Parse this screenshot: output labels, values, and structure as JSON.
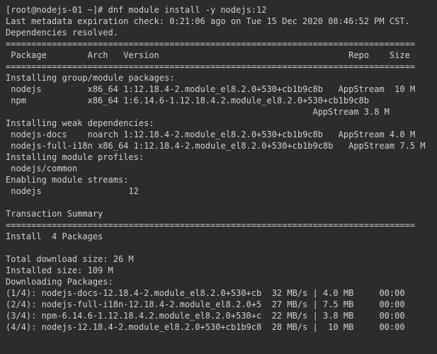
{
  "prompt": "[root@nodejs-01 ~]# ",
  "command": "dnf module install -y nodejs:12",
  "meta_line": "Last metadata expiration check: 0:21:06 ago on Tue 15 Dec 2020 08:46:52 PM CST.",
  "deps_resolved": "Dependencies resolved.",
  "hr": "================================================================================",
  "header": {
    "package": "Package",
    "arch": "Arch",
    "version": "Version",
    "repo": "Repo",
    "size": "Size"
  },
  "sections": {
    "group_packages": "Installing group/module packages:",
    "weak_deps": "Installing weak dependencies:",
    "module_profiles": "Installing module profiles:",
    "module_streams": "Enabling module streams:",
    "transaction_summary": "Transaction Summary",
    "install_n": "Install  4 Packages",
    "total_dl": "Total download size: 26 M",
    "installed_size": "Installed size: 109 M",
    "downloading": "Downloading Packages:"
  },
  "pkg": {
    "nodejs": {
      "name": " nodejs",
      "arch": "x86_64",
      "version": "1:12.18.4-2.module_el8.2.0+530+cb1b9c8b",
      "repo": "AppStream",
      "size": "10 M"
    },
    "npm": {
      "name": " npm",
      "arch": "x86_64",
      "version": "1:6.14.6-1.12.18.4.2.module_el8.2.0+530+cb1b9c8b",
      "repo": "AppStream",
      "size": "3.8 M"
    },
    "nodejs_docs": {
      "name": " nodejs-docs",
      "arch": "noarch",
      "version": "1:12.18.4-2.module_el8.2.0+530+cb1b9c8b",
      "repo": "AppStream",
      "size": "4.0 M"
    },
    "nodejs_full_i18n": {
      "name": " nodejs-full-i18n",
      "arch": "x86_64",
      "version": "1:12.18.4-2.module_el8.2.0+530+cb1b9c8b",
      "repo": "AppStream",
      "size": "7.5 M"
    }
  },
  "profiles": " nodejs/common",
  "streams": {
    "name": " nodejs",
    "ver": "12"
  },
  "dl": {
    "1": {
      "name": "(1/4): nodejs-docs-12.18.4-2.module_el8.2.0+530+cb",
      "speed": "32 MB/s",
      "size": "4.0 MB",
      "time": "00:00"
    },
    "2": {
      "name": "(2/4): nodejs-full-i18n-12.18.4-2.module_el8.2.0+5",
      "speed": "27 MB/s",
      "size": "7.5 MB",
      "time": "00:00"
    },
    "3": {
      "name": "(3/4): npm-6.14.6-1.12.18.4.2.module_el8.2.0+530+c",
      "speed": "22 MB/s",
      "size": "3.8 MB",
      "time": "00:00"
    },
    "4": {
      "name": "(4/4): nodejs-12.18.4-2.module_el8.2.0+530+cb1b9c8",
      "speed": "28 MB/s",
      "size": " 10 MB",
      "time": "00:00"
    }
  }
}
